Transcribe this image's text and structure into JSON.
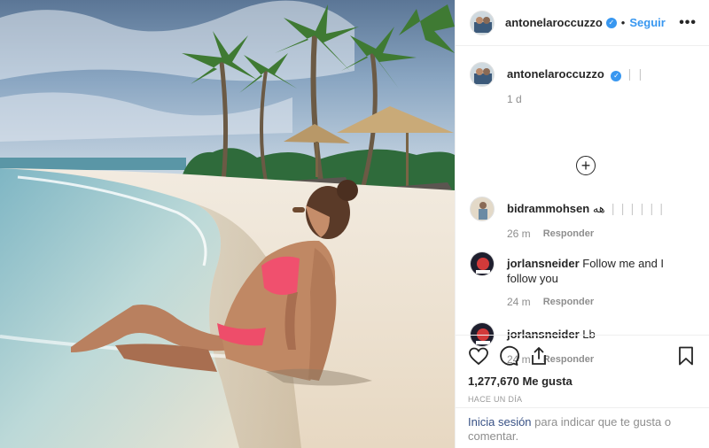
{
  "post": {
    "username": "antonelaroccuzzo",
    "verified_mark": "✓",
    "separator": "•",
    "follow_label": "Seguir",
    "more_label": "•••"
  },
  "caption": {
    "username": "antonelaroccuzzo",
    "text_suffix": "❘❘",
    "age": "1 d",
    "load_more": "+"
  },
  "comments": [
    {
      "username": "bidrammohsen",
      "text": "هه",
      "text_suffix": "❘❘❘❘❘❘",
      "age": "26 m",
      "reply_label": "Responder"
    },
    {
      "username": "jorlansneider",
      "text": "Follow me and I follow you",
      "age": "24 m",
      "reply_label": "Responder"
    },
    {
      "username": "jorlansneider",
      "text": "Lb",
      "age": "24 m",
      "reply_label": "Responder"
    }
  ],
  "actions": {
    "likes": "1,277,670 Me gusta",
    "timestamp": "HACE UN DÍA"
  },
  "login_prompt": {
    "link": "Inicia sesión",
    "text": " para indicar que te gusta o comentar."
  },
  "icons": {
    "like": "heart-icon",
    "comment": "comment-icon",
    "share": "share-icon",
    "save": "bookmark-icon",
    "verified": "verified-badge-icon",
    "load_more": "plus-circle-icon"
  },
  "colors": {
    "accent": "#3897f0",
    "text": "#262626",
    "muted": "#8e8e8e",
    "divider": "#efefef"
  }
}
